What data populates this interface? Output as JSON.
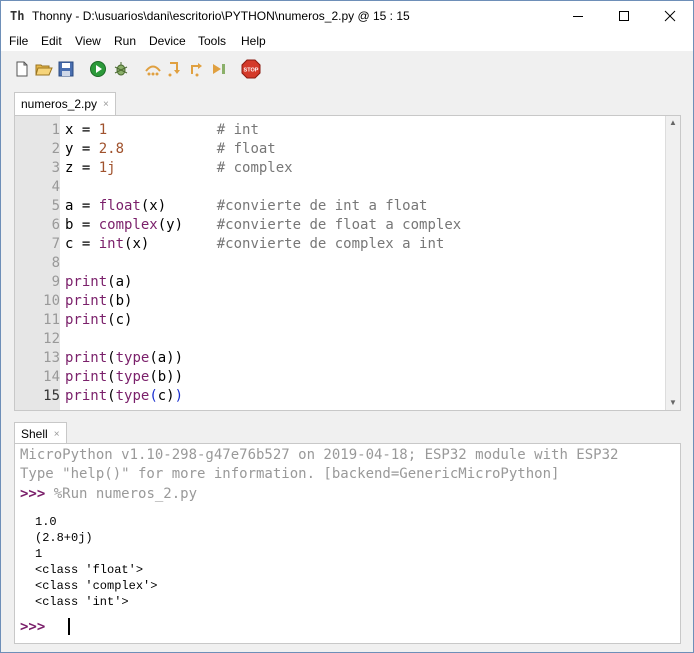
{
  "window": {
    "app_icon_text": "Th",
    "title": "Thonny  -  D:\\usuarios\\dani\\escritorio\\PYTHON\\numeros_2.py  @  15 : 15"
  },
  "menu": [
    "File",
    "Edit",
    "View",
    "Run",
    "Device",
    "Tools",
    "Help"
  ],
  "toolbar": {
    "icons": [
      "new-file-icon",
      "open-file-icon",
      "save-file-icon",
      "run-icon",
      "debug-icon",
      "step-over-icon",
      "step-into-icon",
      "step-out-icon",
      "resume-icon",
      "stop-icon"
    ],
    "stop_label": "STOP"
  },
  "editor_tab": {
    "label": "numeros_2.py",
    "close": "×"
  },
  "editor": {
    "line_numbers": [
      "1",
      "2",
      "3",
      "4",
      "5",
      "6",
      "7",
      "8",
      "9",
      "10",
      "11",
      "12",
      "13",
      "14",
      "15"
    ],
    "lines": [
      "x = 1             # int",
      "y = 2.8           # float",
      "z = 1j            # complex",
      "",
      "a = float(x)      #convierte de int a float",
      "b = complex(y)    #convierte de float a complex",
      "c = int(x)        #convierte de complex a int",
      "",
      "print(a)",
      "print(b)",
      "print(c)",
      "",
      "print(type(a))",
      "print(type(b))",
      "print(type(c))"
    ]
  },
  "shell_tab": {
    "label": "Shell",
    "close": "×"
  },
  "shell": {
    "banner1": "MicroPython v1.10-298-g47e76b527 on 2019-04-18; ESP32 module with ESP32",
    "banner2": "Type \"help()\" for more information. [backend=GenericMicroPython]",
    "prompt": ">>>",
    "run_command": "%Run numeros_2.py",
    "output": [
      "1.0",
      "(2.8+0j)",
      "1",
      "<class 'float'>",
      "<class 'complex'>",
      "<class 'int'>"
    ],
    "final_prompt": ">>>"
  }
}
